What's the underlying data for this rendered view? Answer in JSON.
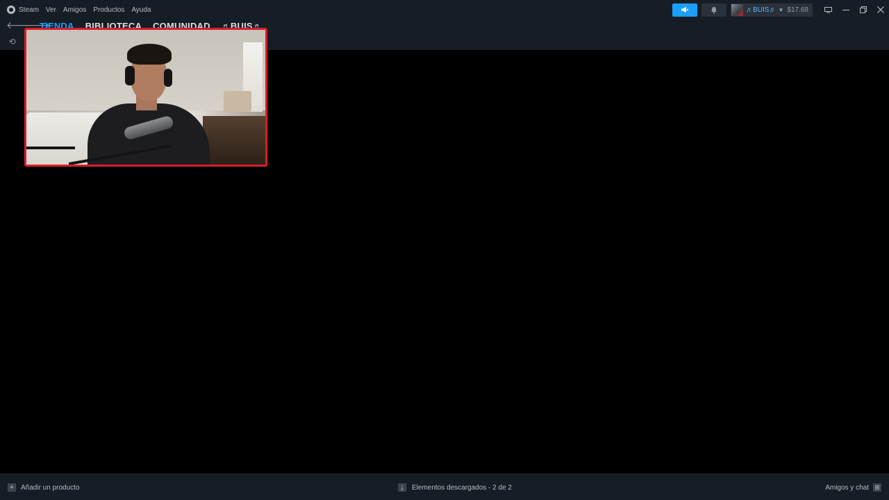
{
  "menu": {
    "steam": "Steam",
    "ver": "Ver",
    "amigos": "Amigos",
    "productos": "Productos",
    "ayuda": "Ayuda"
  },
  "account": {
    "name": "♬BUIS♬",
    "wallet": "$17.68"
  },
  "nav": {
    "tabs": [
      "TIENDA",
      "BIBLIOTECA",
      "COMUNIDAD",
      "♬BUIS♬"
    ],
    "active_tab": "TIENDA"
  },
  "status": {
    "add_product": "Añadir un producto",
    "downloads": "Elementos descargados - 2 de 2",
    "friends": "Amigos y chat"
  },
  "icons": {
    "steam": "steam-logo-icon",
    "announce": "megaphone-icon",
    "notifications": "bell-icon",
    "back": "arrow-left-icon",
    "forward": "arrow-right-icon",
    "reload": "reload-icon",
    "big_picture": "monitor-icon",
    "minimize": "minimize-icon",
    "restore": "restore-icon",
    "close": "close-icon",
    "add": "plus-icon",
    "downloads": "download-icon",
    "chat": "chat-icon"
  },
  "colors": {
    "accent": "#1a9fff",
    "chrome": "#171d25",
    "webcam_border": "#d81e2a"
  }
}
